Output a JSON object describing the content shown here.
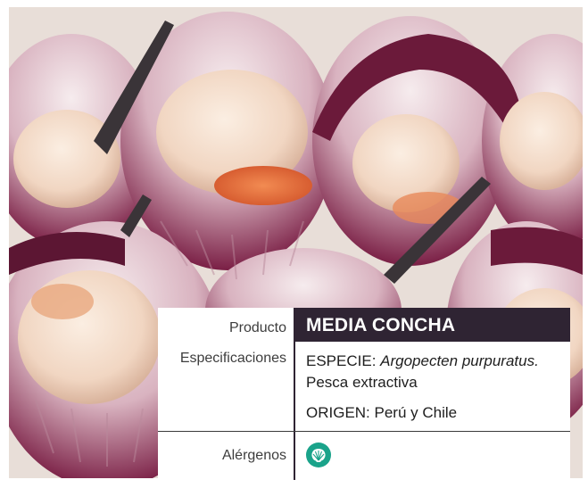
{
  "product": {
    "label": "Producto",
    "value": "MEDIA CONCHA"
  },
  "specifications": {
    "label": "Especificaciones",
    "species_prefix": "ESPECIE: ",
    "species_name": "Argopecten purpuratus.",
    "fishing": "Pesca extractiva",
    "origin": "ORIGEN: Perú y Chile"
  },
  "allergens": {
    "label": "Alérgenos",
    "icon": "shellfish-allergen-icon",
    "badge_color": "#1aa38a"
  },
  "colors": {
    "header_dark": "#2f2433",
    "shell_purple": "#7a1f45",
    "scallop_cream": "#f2dccc"
  }
}
